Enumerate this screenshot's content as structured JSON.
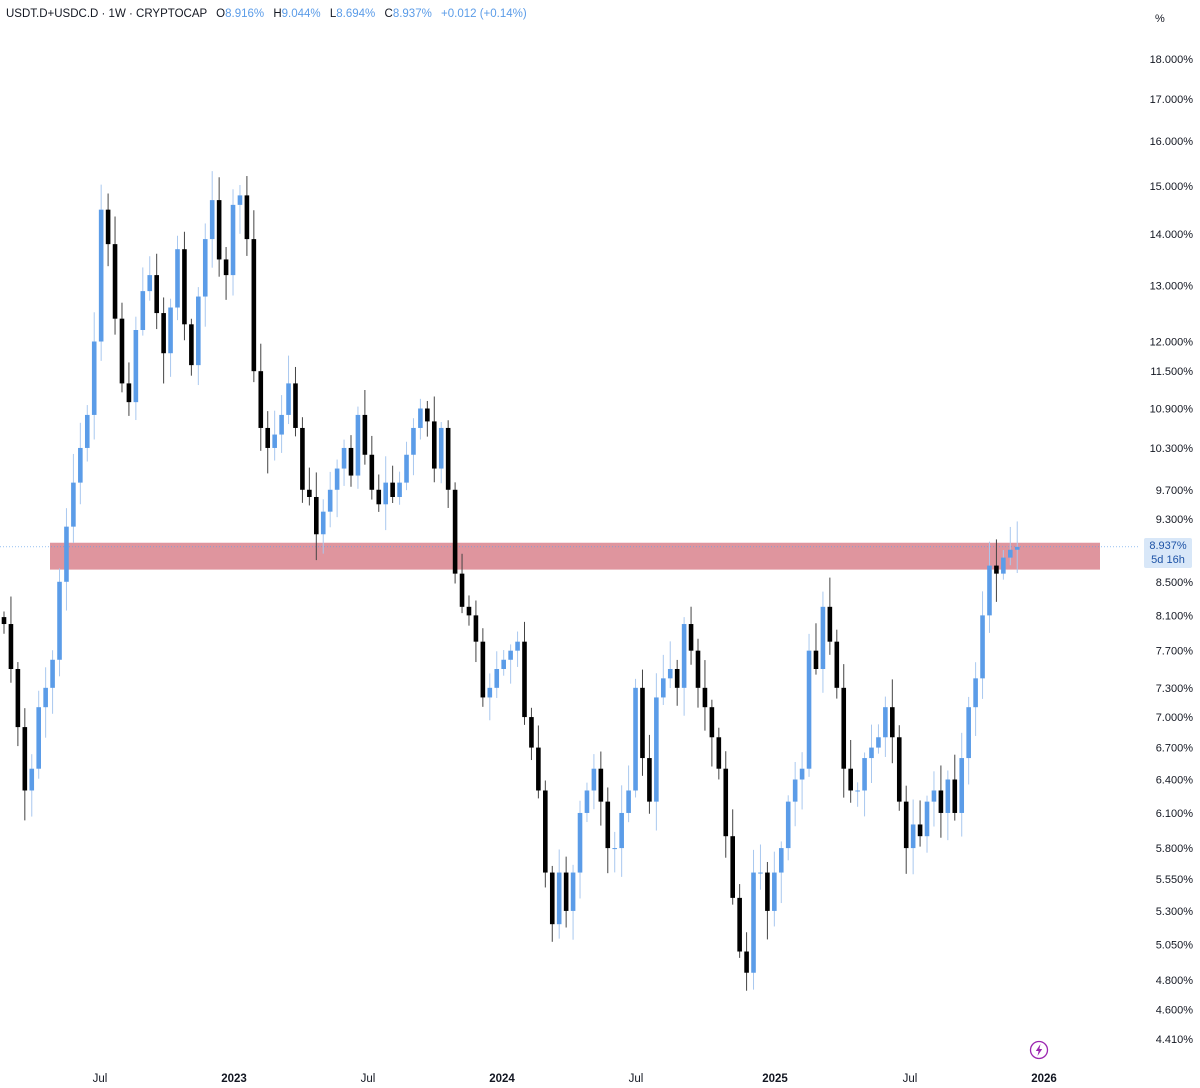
{
  "header": {
    "symbol": "USDT.D+USDC.D · 1W · CRYPTOCAP",
    "open_label": "O",
    "open": "8.916%",
    "high_label": "H",
    "high": "9.044%",
    "low_label": "L",
    "low": "8.694%",
    "close_label": "C",
    "close": "8.937%",
    "change": "+0.012 (+0.14%)"
  },
  "price_axis": {
    "unit": "%"
  },
  "last_price": {
    "value": "8.937%",
    "countdown": "5d 16h"
  },
  "colors": {
    "up_candle": "#5b9ce8",
    "down_candle": "#000000",
    "zone_fill": "#d9838d",
    "price_tag_bg": "#d8e7f8",
    "bolt_icon": "#9c27b0"
  },
  "icons": {
    "alert": "lightning-bolt-icon"
  },
  "chart_data": {
    "type": "candlestick",
    "timeframe": "1W",
    "scale": "log",
    "y_ticks": [
      "18.000%",
      "17.000%",
      "16.000%",
      "15.000%",
      "14.000%",
      "13.000%",
      "12.000%",
      "11.500%",
      "10.900%",
      "10.300%",
      "9.700%",
      "9.300%",
      "8.500%",
      "8.100%",
      "7.700%",
      "7.300%",
      "7.000%",
      "6.700%",
      "6.400%",
      "6.100%",
      "5.800%",
      "5.550%",
      "5.300%",
      "5.050%",
      "4.800%",
      "4.600%",
      "4.410%"
    ],
    "x_ticks": [
      {
        "label": "Jul",
        "bold": false
      },
      {
        "label": "2023",
        "bold": true
      },
      {
        "label": "Jul",
        "bold": false
      },
      {
        "label": "2024",
        "bold": true
      },
      {
        "label": "Jul",
        "bold": false
      },
      {
        "label": "2025",
        "bold": true
      },
      {
        "label": "Jul",
        "bold": false
      },
      {
        "label": "2026",
        "bold": true
      }
    ],
    "ylim": [
      4.35,
      18.6
    ],
    "zone": {
      "low": 8.65,
      "high": 8.99
    },
    "series": [
      {
        "name": "USDT.D+USDC.D",
        "approx_weekly_closes": [
          8.0,
          7.5,
          6.9,
          6.3,
          6.5,
          7.1,
          7.3,
          7.6,
          8.5,
          9.2,
          9.8,
          10.3,
          10.8,
          12.0,
          14.5,
          13.8,
          12.4,
          11.3,
          11.0,
          12.2,
          12.9,
          13.2,
          12.5,
          11.8,
          12.6,
          13.7,
          12.3,
          11.6,
          12.8,
          13.9,
          14.7,
          13.5,
          13.2,
          14.6,
          14.8,
          13.9,
          11.5,
          10.6,
          10.3,
          10.5,
          10.8,
          11.3,
          10.6,
          9.7,
          9.6,
          9.1,
          9.4,
          9.7,
          10.0,
          10.3,
          9.9,
          10.8,
          10.2,
          9.7,
          9.5,
          9.8,
          9.6,
          9.8,
          10.2,
          10.6,
          10.9,
          10.7,
          10.0,
          10.6,
          9.7,
          8.6,
          8.2,
          8.1,
          7.8,
          7.2,
          7.3,
          7.5,
          7.6,
          7.7,
          7.8,
          7.0,
          6.7,
          6.3,
          5.6,
          5.2,
          5.6,
          5.3,
          5.6,
          6.1,
          6.3,
          6.5,
          6.2,
          5.8,
          5.8,
          6.1,
          6.3,
          7.3,
          6.6,
          6.2,
          7.2,
          7.4,
          7.5,
          7.3,
          8.0,
          7.7,
          7.3,
          7.1,
          6.8,
          6.5,
          5.9,
          5.4,
          5.0,
          4.85,
          5.6,
          5.6,
          5.3,
          5.6,
          5.8,
          6.2,
          6.4,
          6.5,
          7.7,
          7.5,
          8.2,
          7.8,
          7.3,
          6.5,
          6.3,
          6.3,
          6.6,
          6.7,
          6.8,
          7.1,
          6.8,
          6.2,
          5.8,
          6.0,
          5.9,
          6.2,
          6.3,
          6.1,
          6.4,
          6.1,
          6.6,
          7.1,
          7.4,
          8.1,
          8.7,
          8.6,
          8.8,
          8.9,
          8.937
        ]
      }
    ]
  }
}
